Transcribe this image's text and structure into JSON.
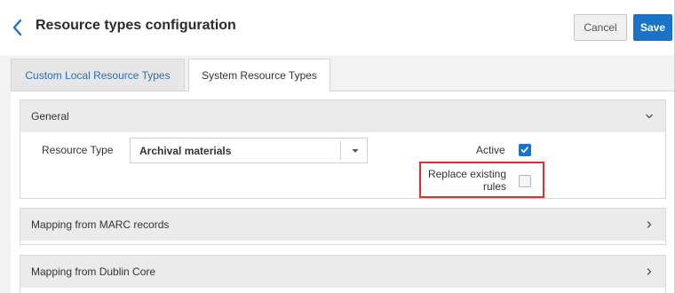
{
  "header": {
    "title": "Resource types configuration",
    "cancel_label": "Cancel",
    "save_label": "Save",
    "back_icon": "chevron-left-icon"
  },
  "tabs": [
    {
      "label": "Custom Local Resource Types",
      "active": false
    },
    {
      "label": "System Resource Types",
      "active": true
    }
  ],
  "sections": {
    "general": {
      "title": "General",
      "expanded": true,
      "resource_type_label": "Resource Type",
      "resource_type_value": "Archival materials",
      "active_label": "Active",
      "active_checked": true,
      "replace_label": "Replace existing rules",
      "replace_checked": false
    },
    "marc": {
      "title": "Mapping from MARC records",
      "expanded": false
    },
    "dublin_core": {
      "title": "Mapping from Dublin Core",
      "expanded": false
    }
  },
  "colors": {
    "accent": "#1a73c9",
    "tab_link": "#2a6fb0",
    "highlight": "#e03131",
    "section_header_bg": "#ebebeb"
  }
}
